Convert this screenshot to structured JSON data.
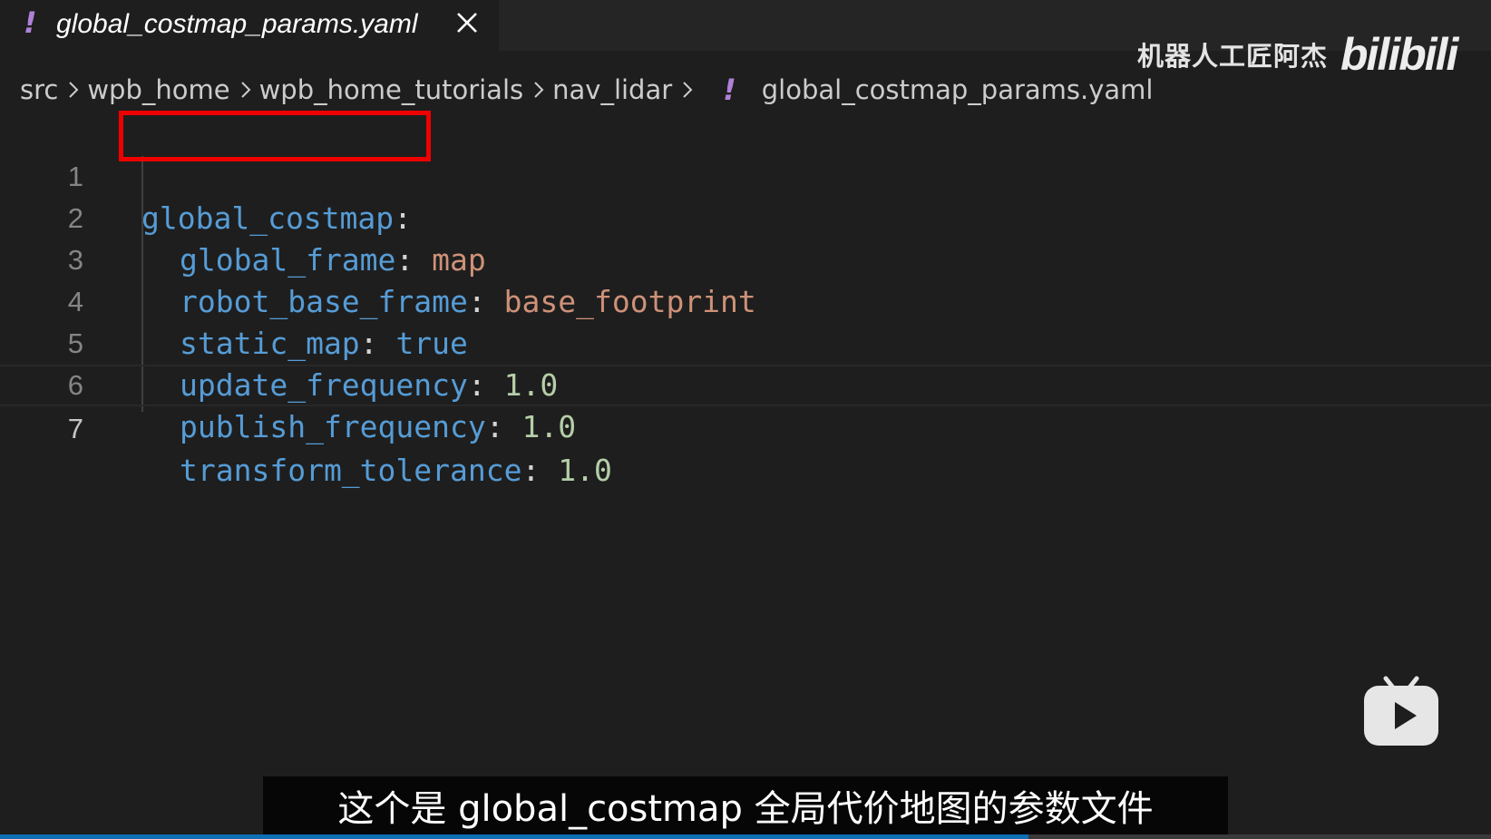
{
  "tab": {
    "warning_glyph": "!",
    "title": "global_costmap_params.yaml",
    "close_icon": "close-icon"
  },
  "breadcrumb": {
    "items": [
      "src",
      "wpb_home",
      "wpb_home_tutorials",
      "nav_lidar"
    ],
    "warning_glyph": "!",
    "file": "global_costmap_params.yaml",
    "separator_icon": "chevron-right-icon"
  },
  "watermark": {
    "channel": "机器人工匠阿杰",
    "logo": "bilibili"
  },
  "editor": {
    "lines": [
      {
        "number": "1",
        "key": "global_costmap",
        "colon": ":",
        "value": "",
        "value_type": "none"
      },
      {
        "number": "2",
        "key": "global_frame",
        "colon": ": ",
        "value": "map",
        "value_type": "string"
      },
      {
        "number": "3",
        "key": "robot_base_frame",
        "colon": ": ",
        "value": "base_footprint",
        "value_type": "string"
      },
      {
        "number": "4",
        "key": "static_map",
        "colon": ": ",
        "value": "true",
        "value_type": "bool"
      },
      {
        "number": "5",
        "key": "update_frequency",
        "colon": ": ",
        "value": "1.0",
        "value_type": "number"
      },
      {
        "number": "6",
        "key": "publish_frequency",
        "colon": ": ",
        "value": "1.0",
        "value_type": "number"
      },
      {
        "number": "7",
        "key": "transform_tolerance",
        "colon": ": ",
        "value": "1.0",
        "value_type": "number"
      }
    ],
    "current_line": "7"
  },
  "subtitle": "这个是 global_costmap 全局代价地图的参数文件",
  "player": {
    "play_icon": "play-icon",
    "progress": 0.69
  },
  "colors": {
    "key": "#569cd6",
    "string": "#ce9178",
    "number": "#b5cea8",
    "highlight_box": "#ee0000",
    "warning": "#b180d7"
  }
}
